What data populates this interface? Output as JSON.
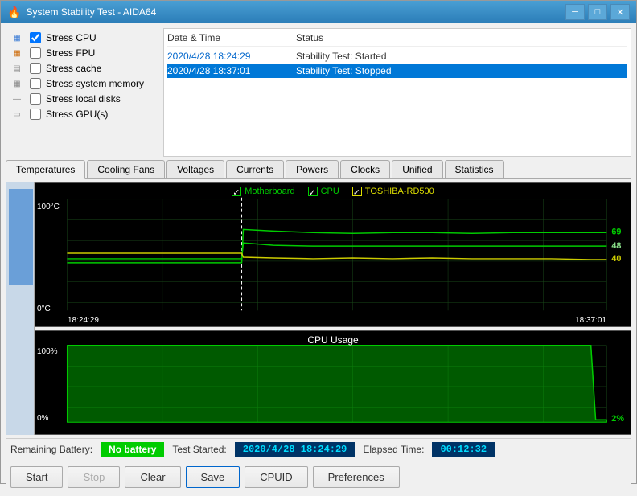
{
  "window": {
    "title": "System Stability Test - AIDA64",
    "icon": "🔥"
  },
  "checkboxes": {
    "items": [
      {
        "id": "cpu",
        "label": "Stress CPU",
        "checked": true,
        "icon": "▦"
      },
      {
        "id": "fpu",
        "label": "Stress FPU",
        "checked": false,
        "icon": "▦"
      },
      {
        "id": "cache",
        "label": "Stress cache",
        "checked": false,
        "icon": "▤"
      },
      {
        "id": "memory",
        "label": "Stress system memory",
        "checked": false,
        "icon": "▦"
      },
      {
        "id": "disks",
        "label": "Stress local disks",
        "checked": false,
        "icon": "—"
      },
      {
        "id": "gpus",
        "label": "Stress GPU(s)",
        "checked": false,
        "icon": "▭"
      }
    ]
  },
  "log": {
    "col_date": "Date & Time",
    "col_status": "Status",
    "rows": [
      {
        "date": "2020/4/28 18:24:29",
        "status": "Stability Test: Started",
        "selected": false
      },
      {
        "date": "2020/4/28 18:37:01",
        "status": "Stability Test: Stopped",
        "selected": true
      }
    ]
  },
  "tabs": {
    "items": [
      {
        "id": "temperatures",
        "label": "Temperatures",
        "active": true
      },
      {
        "id": "cooling-fans",
        "label": "Cooling Fans",
        "active": false
      },
      {
        "id": "voltages",
        "label": "Voltages",
        "active": false
      },
      {
        "id": "currents",
        "label": "Currents",
        "active": false
      },
      {
        "id": "powers",
        "label": "Powers",
        "active": false
      },
      {
        "id": "clocks",
        "label": "Clocks",
        "active": false
      },
      {
        "id": "unified",
        "label": "Unified",
        "active": false
      },
      {
        "id": "statistics",
        "label": "Statistics",
        "active": false
      }
    ]
  },
  "temp_chart": {
    "legend": [
      {
        "id": "mb",
        "label": "Motherboard",
        "color": "#00cc00"
      },
      {
        "id": "cpu",
        "label": "CPU",
        "color": "#00cc00"
      },
      {
        "id": "disk",
        "label": "TOSHIBA-RD500",
        "color": "#dddd00"
      }
    ],
    "y_max": "100°C",
    "y_min": "0°C",
    "x_start": "18:24:29",
    "x_end": "18:37:01",
    "values": {
      "mb": 48,
      "cpu": 69,
      "disk": 40
    }
  },
  "usage_chart": {
    "title": "CPU Usage",
    "y_max": "100%",
    "y_min": "0%",
    "end_value": "2%"
  },
  "status": {
    "battery_label": "Remaining Battery:",
    "battery_value": "No battery",
    "test_started_label": "Test Started:",
    "test_started_value": "2020/4/28 18:24:29",
    "elapsed_label": "Elapsed Time:",
    "elapsed_value": "00:12:32"
  },
  "buttons": {
    "start": "Start",
    "stop": "Stop",
    "clear": "Clear",
    "save": "Save",
    "cpuid": "CPUID",
    "preferences": "Preferences"
  }
}
